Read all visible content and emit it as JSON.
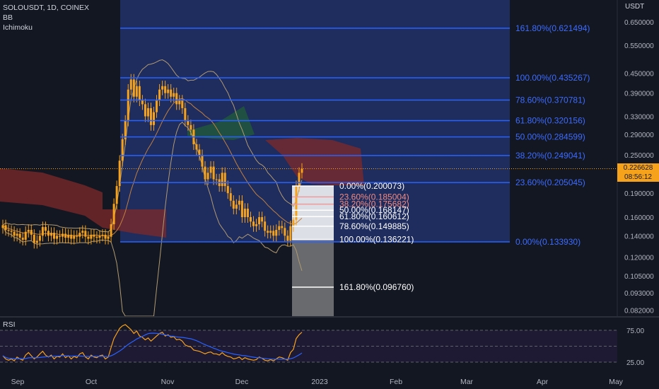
{
  "legend": {
    "symbol": "SOLOUSDT, 1D, COINEX",
    "bb": "BB",
    "ichimoku": "Ichimoku"
  },
  "currency": "USDT",
  "last_price": {
    "value": "0.226628",
    "countdown": "08:56:12",
    "color": "#f7a21b"
  },
  "rsi_label": "RSI",
  "colors": {
    "background": "#131722",
    "candle": "#f7a21b",
    "fib_line": "#2962ff",
    "fib_zone": "#1e2c5e",
    "fib_text": "#3d6bff",
    "cloud_bear": "#7d2a2a",
    "cloud_bull": "#1f5a3a",
    "rsi_line": "#f7a21b",
    "rsi_ma": "#2962ff"
  },
  "chart_data": {
    "type": "candlestick",
    "price_axis": {
      "scale": "log",
      "ticks": [
        "0.650000",
        "0.550000",
        "0.450000",
        "0.390000",
        "0.330000",
        "0.290000",
        "0.250000",
        "0.190000",
        "0.160000",
        "0.140000",
        "0.120000",
        "0.105000",
        "0.093000",
        "0.082000"
      ]
    },
    "time_axis": {
      "ticks": [
        "Sep",
        "Oct",
        "Nov",
        "Dec",
        "2023",
        "Feb",
        "Mar",
        "Apr",
        "May"
      ]
    },
    "series_close": [
      0.151,
      0.146,
      0.145,
      0.144,
      0.14,
      0.142,
      0.138,
      0.136,
      0.144,
      0.146,
      0.141,
      0.133,
      0.135,
      0.14,
      0.149,
      0.145,
      0.14,
      0.143,
      0.137,
      0.14,
      0.139,
      0.142,
      0.138,
      0.141,
      0.137,
      0.14,
      0.139,
      0.143,
      0.145,
      0.139,
      0.137,
      0.141,
      0.139,
      0.138,
      0.14,
      0.141,
      0.137,
      0.139,
      0.152,
      0.176,
      0.2,
      0.24,
      0.28,
      0.32,
      0.4,
      0.43,
      0.38,
      0.41,
      0.37,
      0.36,
      0.33,
      0.35,
      0.31,
      0.34,
      0.37,
      0.4,
      0.41,
      0.39,
      0.4,
      0.38,
      0.39,
      0.36,
      0.37,
      0.35,
      0.32,
      0.31,
      0.3,
      0.27,
      0.26,
      0.25,
      0.23,
      0.21,
      0.22,
      0.23,
      0.21,
      0.21,
      0.2,
      0.22,
      0.2,
      0.19,
      0.18,
      0.17,
      0.175,
      0.18,
      0.16,
      0.17,
      0.16,
      0.155,
      0.15,
      0.152,
      0.16,
      0.155,
      0.145,
      0.143,
      0.145,
      0.14,
      0.146,
      0.15,
      0.148,
      0.14,
      0.135,
      0.15,
      0.157,
      0.2,
      0.22,
      0.2266
    ],
    "fib_main": {
      "levels": [
        {
          "label": "161.80%(0.621494)",
          "price": 0.621494
        },
        {
          "label": "100.00%(0.435267)",
          "price": 0.435267
        },
        {
          "label": "78.60%(0.370781)",
          "price": 0.370781
        },
        {
          "label": "61.80%(0.320156)",
          "price": 0.320156
        },
        {
          "label": "50.00%(0.284599)",
          "price": 0.284599
        },
        {
          "label": "38.20%(0.249041)",
          "price": 0.249041
        },
        {
          "label": "23.60%(0.205045)",
          "price": 0.205045
        },
        {
          "label": "0.00%(0.133930)",
          "price": 0.13393
        }
      ]
    },
    "fib_small": {
      "levels": [
        {
          "label": "0.00%(0.200073)",
          "price": 0.200073
        },
        {
          "label": "23.60%(0.185004)",
          "price": 0.185004
        },
        {
          "label": "38.20%(0.175682)",
          "price": 0.175682
        },
        {
          "label": "50.00%(0.168147)",
          "price": 0.168147
        },
        {
          "label": "61.80%(0.160612)",
          "price": 0.160612
        },
        {
          "label": "78.60%(0.149885)",
          "price": 0.149885
        },
        {
          "label": "100.00%(0.136221)",
          "price": 0.136221
        },
        {
          "label": "161.80%(0.096760)",
          "price": 0.09676
        }
      ]
    },
    "rsi": {
      "ticks": [
        "75.00",
        "25.00"
      ],
      "values": [
        35,
        30,
        28,
        30,
        27,
        33,
        30,
        28,
        36,
        40,
        35,
        30,
        33,
        38,
        42,
        36,
        33,
        36,
        30,
        34,
        33,
        38,
        32,
        35,
        30,
        34,
        32,
        38,
        40,
        33,
        30,
        36,
        33,
        32,
        35,
        36,
        30,
        33,
        48,
        62,
        70,
        78,
        82,
        84,
        80,
        76,
        70,
        74,
        66,
        64,
        60,
        63,
        58,
        62,
        66,
        70,
        72,
        66,
        68,
        64,
        65,
        60,
        61,
        58,
        52,
        50,
        49,
        44,
        43,
        42,
        40,
        38,
        40,
        41,
        38,
        38,
        36,
        40,
        36,
        34,
        33,
        30,
        31,
        33,
        29,
        32,
        30,
        29,
        28,
        29,
        33,
        31,
        28,
        27,
        29,
        27,
        30,
        33,
        32,
        30,
        28,
        40,
        45,
        62,
        68,
        72
      ]
    }
  }
}
